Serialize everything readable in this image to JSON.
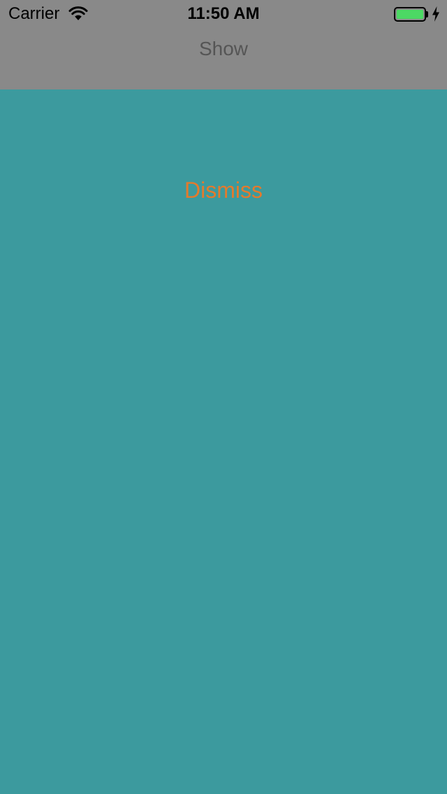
{
  "status_bar": {
    "carrier": "Carrier",
    "time": "11:50 AM",
    "wifi_icon": "wifi-icon",
    "battery_icon": "battery-icon",
    "charging_icon": "charging-bolt-icon",
    "battery_level": 1.0,
    "battery_color": "#4cd964"
  },
  "header": {
    "show_label": "Show",
    "show_label_color": "#555555",
    "background_color": "#898989"
  },
  "main": {
    "dismiss_label": "Dismiss",
    "dismiss_color": "#e57a2b",
    "background_color": "#3c9a9e"
  }
}
